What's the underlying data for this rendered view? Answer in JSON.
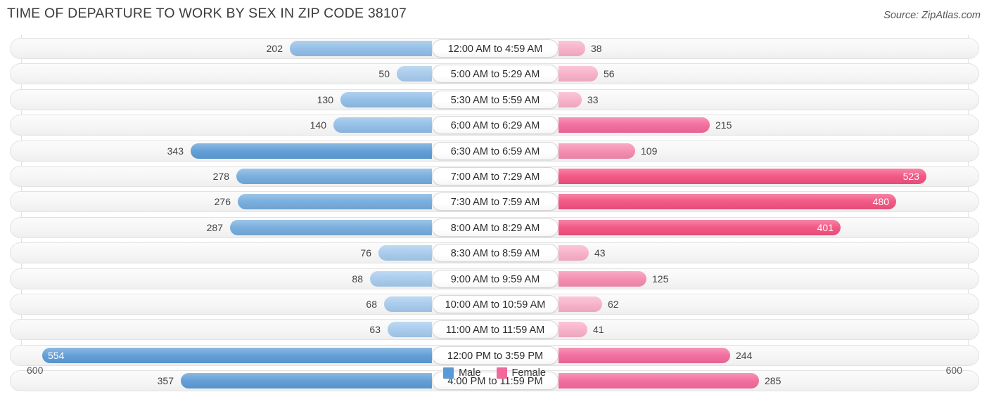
{
  "header": {
    "title": "TIME OF DEPARTURE TO WORK BY SEX IN ZIP CODE 38107",
    "source": "Source: ZipAtlas.com"
  },
  "legend": {
    "male_label": "Male",
    "female_label": "Female",
    "male_color": "#5B9BD5",
    "female_color": "#F2689A"
  },
  "axis": {
    "left_label": "600",
    "right_label": "600"
  },
  "chart_data": {
    "type": "bar",
    "title": "TIME OF DEPARTURE TO WORK BY SEX IN ZIP CODE 38107",
    "subtitle": "Source: ZipAtlas.com",
    "orientation": "horizontal-diverging",
    "xlabel": "",
    "ylabel": "",
    "xlim": [
      600,
      600
    ],
    "grid": false,
    "legend_position": "bottom-center",
    "categories": [
      "12:00 AM to 4:59 AM",
      "5:00 AM to 5:29 AM",
      "5:30 AM to 5:59 AM",
      "6:00 AM to 6:29 AM",
      "6:30 AM to 6:59 AM",
      "7:00 AM to 7:29 AM",
      "7:30 AM to 7:59 AM",
      "8:00 AM to 8:29 AM",
      "8:30 AM to 8:59 AM",
      "9:00 AM to 9:59 AM",
      "10:00 AM to 10:59 AM",
      "11:00 AM to 11:59 AM",
      "12:00 PM to 3:59 PM",
      "4:00 PM to 11:59 PM"
    ],
    "series": [
      {
        "name": "Male",
        "color": "#5B9BD5",
        "values": [
          202,
          50,
          130,
          140,
          343,
          278,
          276,
          287,
          76,
          88,
          68,
          63,
          554,
          357
        ]
      },
      {
        "name": "Female",
        "color": "#F2689A",
        "values": [
          38,
          56,
          33,
          215,
          109,
          523,
          480,
          401,
          43,
          125,
          62,
          41,
          244,
          285
        ]
      }
    ]
  },
  "rows": [
    {
      "label": "12:00 AM to 4:59 AM",
      "male": 202,
      "female": 38,
      "male_text": "202",
      "female_text": "38"
    },
    {
      "label": "5:00 AM to 5:29 AM",
      "male": 50,
      "female": 56,
      "male_text": "50",
      "female_text": "56"
    },
    {
      "label": "5:30 AM to 5:59 AM",
      "male": 130,
      "female": 33,
      "male_text": "130",
      "female_text": "33"
    },
    {
      "label": "6:00 AM to 6:29 AM",
      "male": 140,
      "female": 215,
      "male_text": "140",
      "female_text": "215"
    },
    {
      "label": "6:30 AM to 6:59 AM",
      "male": 343,
      "female": 109,
      "male_text": "343",
      "female_text": "109"
    },
    {
      "label": "7:00 AM to 7:29 AM",
      "male": 278,
      "female": 523,
      "male_text": "278",
      "female_text": "523"
    },
    {
      "label": "7:30 AM to 7:59 AM",
      "male": 276,
      "female": 480,
      "male_text": "276",
      "female_text": "480"
    },
    {
      "label": "8:00 AM to 8:29 AM",
      "male": 287,
      "female": 401,
      "male_text": "287",
      "female_text": "401"
    },
    {
      "label": "8:30 AM to 8:59 AM",
      "male": 76,
      "female": 43,
      "male_text": "76",
      "female_text": "43"
    },
    {
      "label": "9:00 AM to 9:59 AM",
      "male": 88,
      "female": 125,
      "male_text": "88",
      "female_text": "125"
    },
    {
      "label": "10:00 AM to 10:59 AM",
      "male": 68,
      "female": 62,
      "male_text": "68",
      "female_text": "62"
    },
    {
      "label": "11:00 AM to 11:59 AM",
      "male": 63,
      "female": 41,
      "male_text": "63",
      "female_text": "41"
    },
    {
      "label": "12:00 PM to 3:59 PM",
      "male": 554,
      "female": 244,
      "male_text": "554",
      "female_text": "244"
    },
    {
      "label": "4:00 PM to 11:59 PM",
      "male": 357,
      "female": 285,
      "male_text": "357",
      "female_text": "285"
    }
  ]
}
